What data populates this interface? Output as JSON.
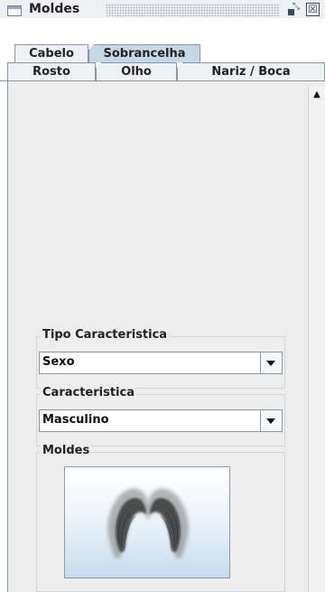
{
  "window": {
    "title": "Moldes",
    "restore_glyph": "⤡",
    "close_glyph": "☒"
  },
  "tabs_top": [
    {
      "label": "Cabelo",
      "selected": false
    },
    {
      "label": "Sobrancelha",
      "selected": true
    }
  ],
  "tabs_bottom": [
    {
      "label": "Rosto"
    },
    {
      "label": "Olho"
    },
    {
      "label": "Nariz / Boca"
    }
  ],
  "tipo": {
    "legend": "Tipo Caracteristica",
    "value": "Sexo"
  },
  "caracteristica": {
    "legend": "Caracteristica",
    "value": "Masculino"
  },
  "moldes": {
    "legend": "Moldes"
  },
  "scroll": {
    "up_glyph": "▲"
  },
  "colors": {
    "selected_tab": "#c7d7ea",
    "panel_bg": "#ededed",
    "border": "#8b97a7"
  }
}
